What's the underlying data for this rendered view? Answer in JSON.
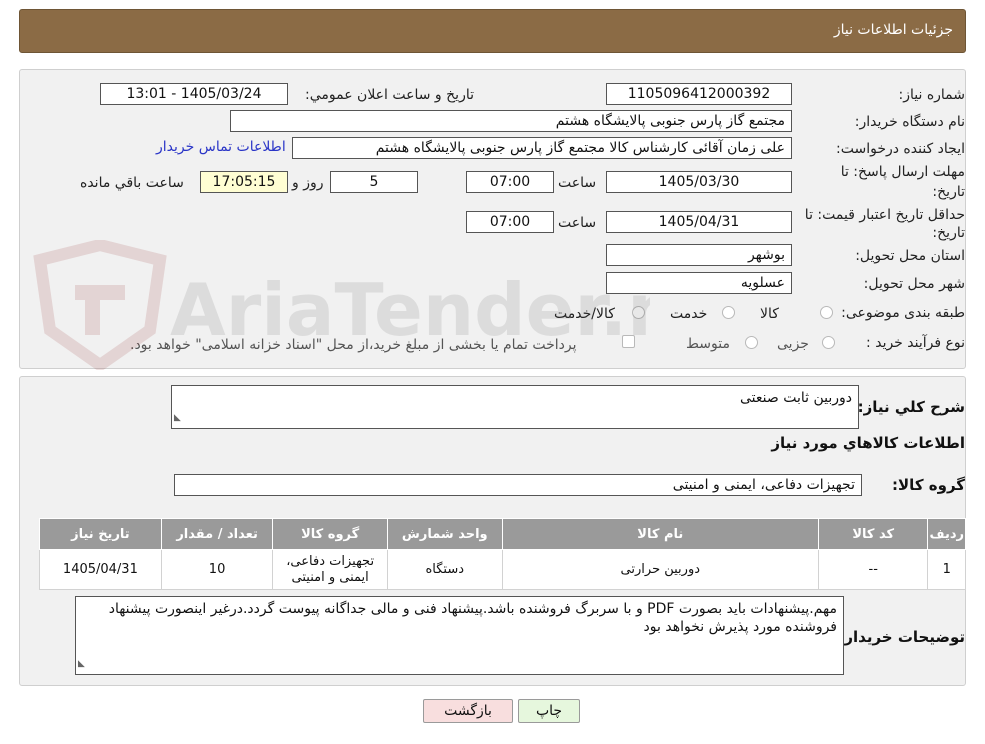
{
  "header": {
    "title": "جزئیات اطلاعات نیاز"
  },
  "form": {
    "need_number": {
      "label": "شماره نیاز:",
      "value": "1105096412000392"
    },
    "announce_datetime": {
      "label": "تاریخ و ساعت اعلان عمومي:",
      "value": "1405/03/24 - 13:01"
    },
    "buyer_org": {
      "label": "نام دستگاه خریدار:",
      "value": "مجتمع گاز پارس جنوبی  پالایشگاه هشتم"
    },
    "requester": {
      "label": "ایجاد کننده درخواست:",
      "value": "علی زمان آقائی کارشناس کالا مجتمع گاز پارس جنوبی  پالایشگاه هشتم",
      "contact_link": "اطلاعات تماس خریدار"
    },
    "reply_deadline": {
      "label_line1": "مهلت ارسال پاسخ: تا",
      "label_line2": "تاریخ:",
      "date": "1405/03/30",
      "time_label": "ساعت",
      "time": "07:00",
      "days": "5",
      "days_label": "روز و",
      "remaining": "17:05:15",
      "remaining_label": "ساعت باقي مانده"
    },
    "price_validity": {
      "label_line1": "حداقل تاریخ اعتبار قیمت: تا",
      "label_line2": "تاریخ:",
      "date": "1405/04/31",
      "time_label": "ساعت",
      "time": "07:00"
    },
    "province": {
      "label": "استان محل تحویل:",
      "value": "بوشهر"
    },
    "city": {
      "label": "شهر محل تحویل:",
      "value": "عسلویه"
    },
    "category": {
      "label": "طبقه بندی موضوعی:",
      "options": [
        "کالا",
        "خدمت",
        "کالا/خدمت"
      ]
    },
    "purchase_type": {
      "label": "نوع فرآیند خرید :",
      "options": [
        "جزیی",
        "متوسط"
      ],
      "note": "پرداخت تمام یا بخشی از مبلغ خرید،از محل \"اسناد خزانه اسلامی\" خواهد بود."
    }
  },
  "details": {
    "summary_label": "شرح کلي نیاز:",
    "summary_value": "دوربین ثابت صنعتی",
    "items_heading": "اطلاعات کالاهاي مورد نیاز",
    "goods_group_label": "گروه کالا:",
    "goods_group_value": "تجهیزات دفاعی، ایمنی و امنیتی",
    "table": {
      "headers": [
        "ردیف",
        "کد کالا",
        "نام کالا",
        "واحد شمارش",
        "گروه کالا",
        "تعداد / مقدار",
        "تاریخ نیاز"
      ],
      "rows": [
        [
          "1",
          "--",
          "دوربین حرارتی",
          "دستگاه",
          "تجهیزات دفاعی، ایمنی و امنیتی",
          "10",
          "1405/04/31"
        ]
      ]
    },
    "buyer_notes_label": "توضیحات خریدار:",
    "buyer_notes_value": "مهم.پیشنهادات باید بصورت PDF و با سربرگ فروشنده باشد.پیشنهاد فنی و مالی جداگانه پیوست گردد.درغیر اینصورت پیشنهاد فروشنده مورد پذیرش نخواهد بود"
  },
  "buttons": {
    "back": "بازگشت",
    "print": "چاپ"
  },
  "watermark": {
    "text": "AriaTender.neT"
  },
  "colors": {
    "header_bg": "#8b6b45",
    "link": "#2a35c7",
    "table_header": "#9a9a9a"
  }
}
